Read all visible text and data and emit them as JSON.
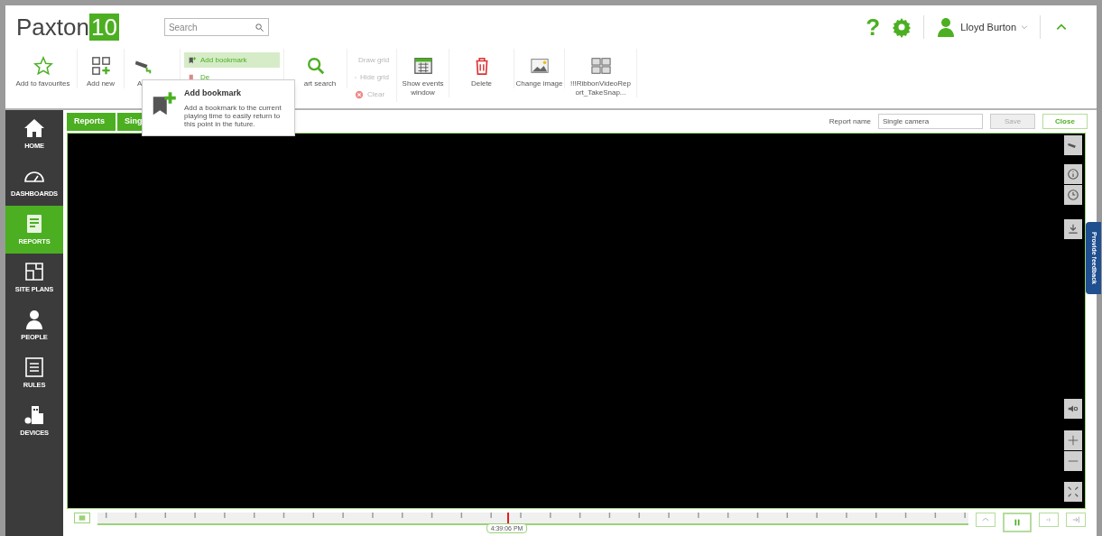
{
  "header": {
    "logo_text": "Paxton",
    "logo_badge": "10",
    "search": {
      "placeholder": "Search"
    },
    "help": "?",
    "user": "Lloyd Burton"
  },
  "ribbon": [
    {
      "kind": "large",
      "label": "Add to favourites"
    },
    {
      "kind": "large",
      "label": "Add new"
    },
    {
      "kind": "large",
      "label": "A"
    },
    {
      "kind": "small",
      "items": [
        {
          "label": "Add bookmark",
          "disabled": false,
          "highlighted": true
        },
        {
          "label": "De",
          "disabled": false,
          "highlighted": false
        }
      ]
    },
    {
      "kind": "large",
      "label": "art search"
    },
    {
      "kind": "small",
      "items": [
        {
          "label": "Draw grid",
          "disabled": true,
          "highlighted": false
        },
        {
          "label": "Hide grid",
          "disabled": true,
          "highlighted": false
        },
        {
          "label": "Clear",
          "disabled": true,
          "highlighted": false
        }
      ]
    },
    {
      "kind": "large",
      "label": "Show events window"
    },
    {
      "kind": "large",
      "label": "Delete"
    },
    {
      "kind": "large",
      "label": "Change image"
    },
    {
      "kind": "large",
      "label": "!!!RibbonVideoReport_TakeSnap..."
    }
  ],
  "tooltip": {
    "title": "Add bookmark",
    "text": "Add a bookmark to the current playing time to easily return to this point in the future."
  },
  "sidebar": [
    {
      "label": "HOME",
      "selected": false
    },
    {
      "label": "DASHBOARDS",
      "selected": false
    },
    {
      "label": "REPORTS",
      "selected": true
    },
    {
      "label": "SITE PLANS",
      "selected": false
    },
    {
      "label": "PEOPLE",
      "selected": false
    },
    {
      "label": "RULES",
      "selected": false
    },
    {
      "label": "DEVICES",
      "selected": false
    }
  ],
  "breadcrumb": [
    "Reports",
    "Sing"
  ],
  "report_name": {
    "label": "Report name",
    "value": "Single camera",
    "save": {
      "label": "Save",
      "disabled": true
    },
    "close": "Close"
  },
  "feedback": "Provide feedback",
  "timeline": {
    "time": "4:39:06 PM",
    "level": 0.47
  }
}
